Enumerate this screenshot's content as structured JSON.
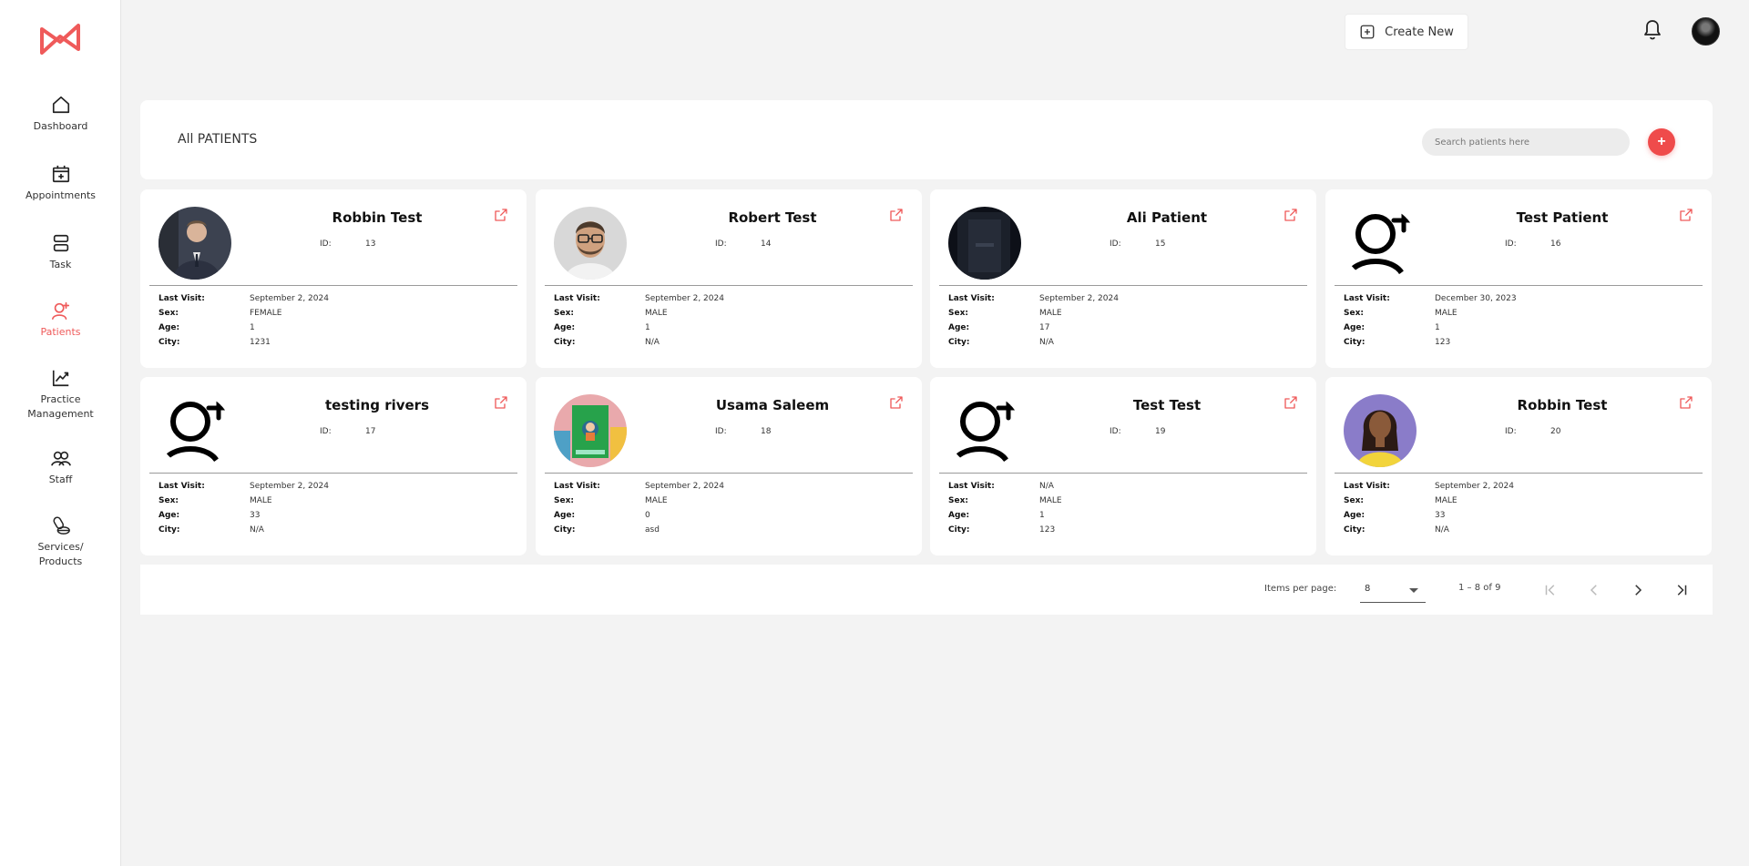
{
  "brand": {
    "accent": "#ef4b4b"
  },
  "sidebar": {
    "items": [
      {
        "label": "Dashboard",
        "icon": "home-icon",
        "active": false
      },
      {
        "label": "Appointments",
        "icon": "calendar-plus-icon",
        "active": false
      },
      {
        "label": "Task",
        "icon": "task-icon",
        "active": false
      },
      {
        "label": "Patients",
        "icon": "user-plus-icon",
        "active": true
      },
      {
        "label": "Practice Management",
        "icon": "chart-line-icon",
        "active": false
      },
      {
        "label": "Staff",
        "icon": "users-icon",
        "active": false
      },
      {
        "label": "Services/ Products",
        "icon": "pills-icon",
        "active": false
      }
    ]
  },
  "topbar": {
    "create_label": "Create New"
  },
  "header": {
    "title": "All PATIENTS",
    "search_placeholder": "Search patients here",
    "add_label": "+"
  },
  "labels": {
    "id": "ID:",
    "last_visit": "Last Visit:",
    "sex": "Sex:",
    "age": "Age:",
    "city": "City:"
  },
  "patients": [
    {
      "name": "Robbin Test",
      "id": "13",
      "last_visit": "September 2, 2024",
      "sex": "FEMALE",
      "age": "1",
      "city": "1231",
      "avatar": "suit"
    },
    {
      "name": "Robert Test",
      "id": "14",
      "last_visit": "September 2, 2024",
      "sex": "MALE",
      "age": "1",
      "city": "N/A",
      "avatar": "glasses"
    },
    {
      "name": "Ali Patient",
      "id": "15",
      "last_visit": "September 2, 2024",
      "sex": "MALE",
      "age": "17",
      "city": "N/A",
      "avatar": "dark"
    },
    {
      "name": "Test Patient",
      "id": "16",
      "last_visit": "December 30, 2023",
      "sex": "MALE",
      "age": "1",
      "city": "123",
      "avatar": "placeholder"
    },
    {
      "name": "testing rivers",
      "id": "17",
      "last_visit": "September 2, 2024",
      "sex": "MALE",
      "age": "33",
      "city": "N/A",
      "avatar": "placeholder"
    },
    {
      "name": "Usama Saleem",
      "id": "18",
      "last_visit": "September 2, 2024",
      "sex": "MALE",
      "age": "0",
      "city": "asd",
      "avatar": "book"
    },
    {
      "name": "Test Test",
      "id": "19",
      "last_visit": "N/A",
      "sex": "MALE",
      "age": "1",
      "city": "123",
      "avatar": "placeholder"
    },
    {
      "name": "Robbin Test",
      "id": "20",
      "last_visit": "September 2, 2024",
      "sex": "MALE",
      "age": "33",
      "city": "N/A",
      "avatar": "woman"
    }
  ],
  "pagination": {
    "items_per_page_label": "Items per page:",
    "items_per_page": "8",
    "range": "1 – 8 of 9"
  }
}
